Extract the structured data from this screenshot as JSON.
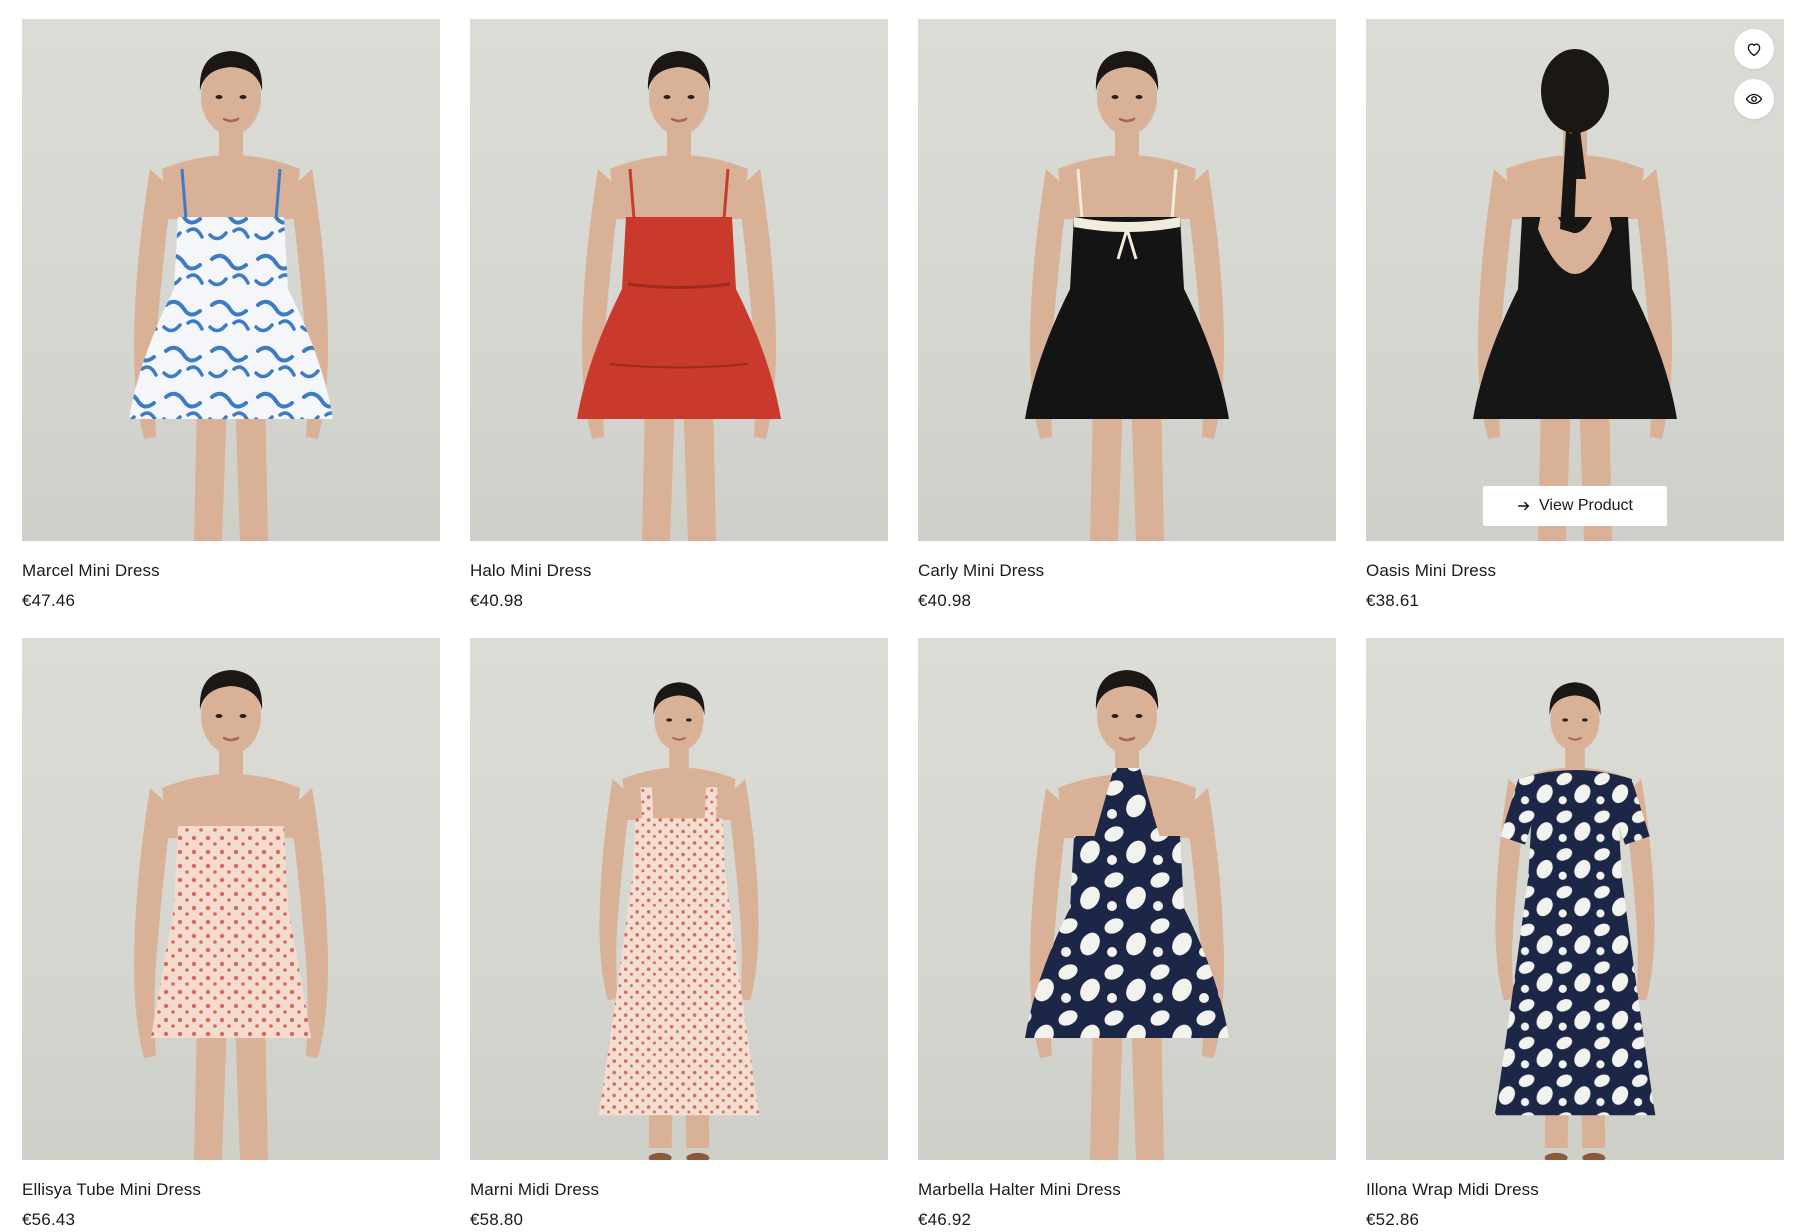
{
  "products": [
    {
      "name": "Marcel Mini Dress",
      "price": "€47.46",
      "dress_color": "#f4f6fa",
      "accent_color": "#3b7cc4",
      "pattern": "floral-blue",
      "length": "mini",
      "straps": "thin"
    },
    {
      "name": "Halo Mini Dress",
      "price": "€40.98",
      "dress_color": "#c93a2c",
      "accent_color": "#a82c21",
      "pattern": "solid",
      "length": "mini",
      "straps": "thin"
    },
    {
      "name": "Carly Mini Dress",
      "price": "€40.98",
      "dress_color": "#141414",
      "accent_color": "#f2ecdc",
      "pattern": "solid",
      "length": "mini",
      "straps": "thin"
    },
    {
      "name": "Oasis Mini Dress",
      "price": "€38.61",
      "dress_color": "#161616",
      "accent_color": "#161616",
      "pattern": "solid",
      "length": "mini",
      "straps": "halter-back"
    },
    {
      "name": "Ellisya Tube Mini Dress",
      "price": "€56.43",
      "dress_color": "#f3dccd",
      "accent_color": "#d9685a",
      "pattern": "ditsy",
      "length": "mini",
      "straps": "none"
    },
    {
      "name": "Marni Midi Dress",
      "price": "€58.80",
      "dress_color": "#f3ded2",
      "accent_color": "#d46a5c",
      "pattern": "ditsy",
      "length": "midi",
      "straps": "wide"
    },
    {
      "name": "Marbella Halter Mini Dress",
      "price": "€46.92",
      "dress_color": "#1c2647",
      "accent_color": "#f2f2ee",
      "pattern": "floral-navy",
      "length": "mini",
      "straps": "halter"
    },
    {
      "name": "Illona Wrap Midi Dress",
      "price": "€52.86",
      "dress_color": "#1c2647",
      "accent_color": "#f2f2ee",
      "pattern": "floral-navy",
      "length": "midi",
      "straps": "sleeves"
    }
  ],
  "hover_card": {
    "wishlist_icon": "heart-icon",
    "quickview_icon": "eye-icon",
    "view_label": "View Product",
    "view_icon": "arrow-right-icon"
  },
  "colors": {
    "photo_bg": "#d8d8d3",
    "skin": "#d9b197",
    "hair": "#1b1714",
    "text": "#1a1a1a"
  }
}
